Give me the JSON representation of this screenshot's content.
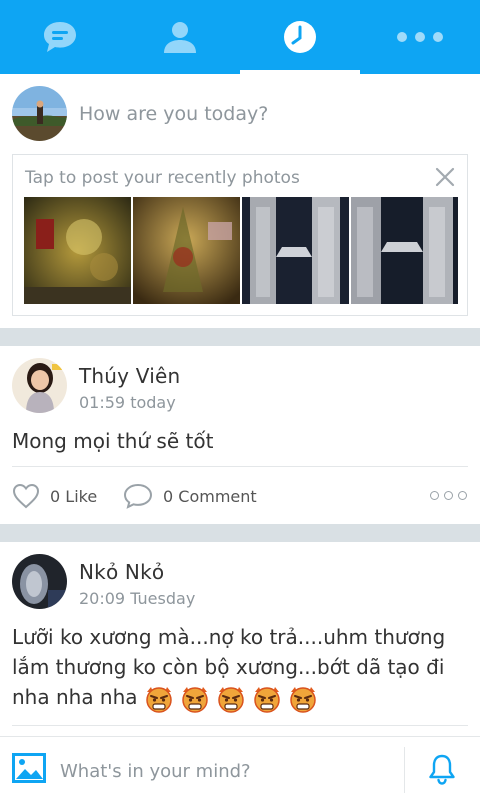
{
  "nav": {
    "tabs": [
      {
        "icon": "chat-bubble-icon"
      },
      {
        "icon": "contacts-icon"
      },
      {
        "icon": "clock-icon",
        "active": true
      },
      {
        "icon": "more-icon"
      }
    ],
    "accent": "#0ea5f3"
  },
  "composer": {
    "placeholder": "How are you today?"
  },
  "recent_photos": {
    "title": "Tap to post your recently photos",
    "count": 4
  },
  "posts": [
    {
      "name": "Thúy Viên",
      "time": "01:59 today",
      "text": "Mong mọi thứ sẽ tốt",
      "likes": "0",
      "like_label": "Like",
      "comments": "0",
      "comment_label": "Comment"
    },
    {
      "name": "Nkỏ Nkỏ",
      "time": "20:09 Tuesday",
      "text": "Lưỡi ko xương mà...nợ ko trả....uhm thương lắm thương ko còn bộ xương...bớt dã tạo đi nha nha nha",
      "emoji_count": 5
    }
  ],
  "bottom": {
    "placeholder": "What's in your mind?"
  }
}
